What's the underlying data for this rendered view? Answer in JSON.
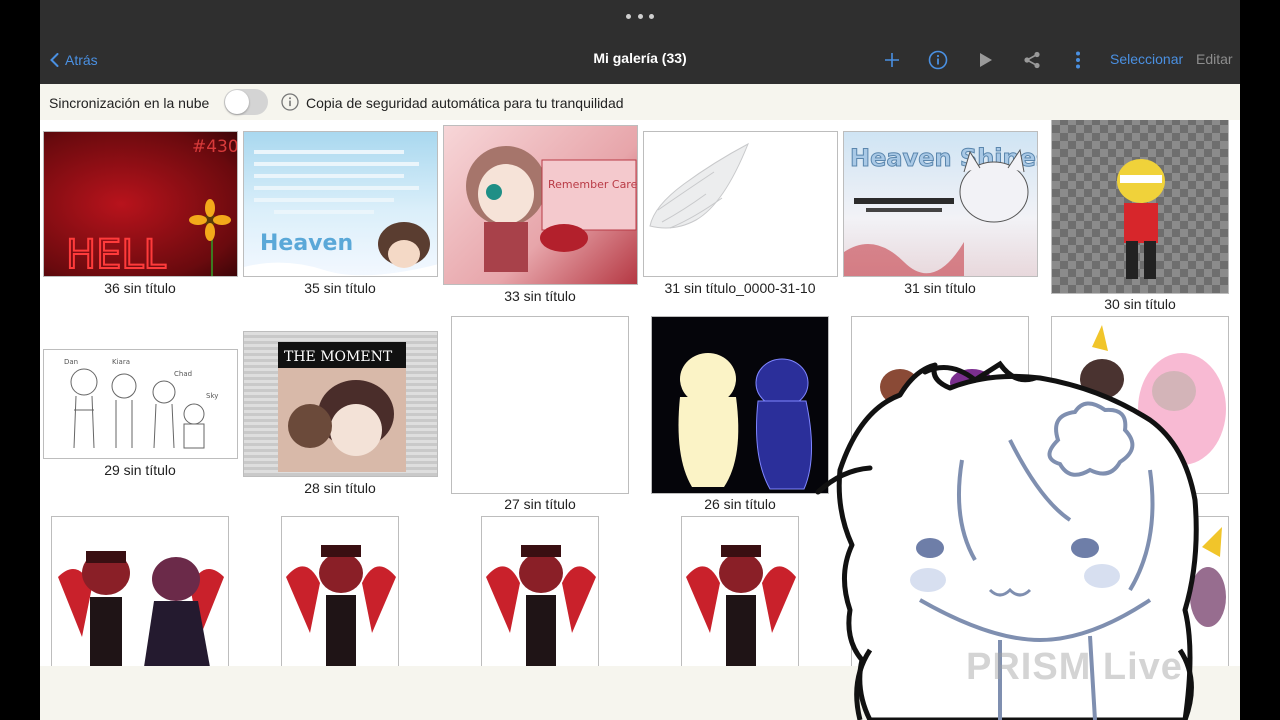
{
  "header": {
    "back_label": "Atrás",
    "title": "Mi galería (33)",
    "select_label": "Seleccionar",
    "edit_label": "Editar",
    "icons": [
      "plus-icon",
      "info-icon",
      "play-icon",
      "share-icon",
      "more-vertical-icon"
    ]
  },
  "sync": {
    "label": "Sincronización en la nube",
    "enabled": false,
    "backup_text": "Copia de seguridad automática para tu tranquilidad"
  },
  "gallery": {
    "items": [
      {
        "caption": "36 sin título",
        "art": "HELL",
        "badge": "#430"
      },
      {
        "caption": "35 sin título",
        "art": "Heaven"
      },
      {
        "caption": "33 sin título",
        "art": "Remember Care Your Self"
      },
      {
        "caption": "31 sin título_0000-31-10"
      },
      {
        "caption": "31 sin título",
        "art": "Heaven Shines with the Souls"
      },
      {
        "caption": "30 sin título"
      },
      {
        "caption": "29 sin título",
        "sketch_names": [
          "Dan",
          "Kiara",
          "Chad",
          "Sky"
        ]
      },
      {
        "caption": "28 sin título",
        "art": "THE MOMENT"
      },
      {
        "caption": "27 sin título"
      },
      {
        "caption": "26 sin título"
      },
      {
        "caption": ""
      },
      {
        "caption": ""
      },
      {
        "caption": ""
      },
      {
        "caption": ""
      },
      {
        "caption": ""
      },
      {
        "caption": ""
      },
      {
        "caption": ""
      },
      {
        "caption": ""
      }
    ]
  },
  "overlay": {
    "watermark": "PRISM Live"
  },
  "colors": {
    "topbar": "#2f2f2f",
    "accent": "#4a90e2",
    "background": "#f6f5ee"
  }
}
